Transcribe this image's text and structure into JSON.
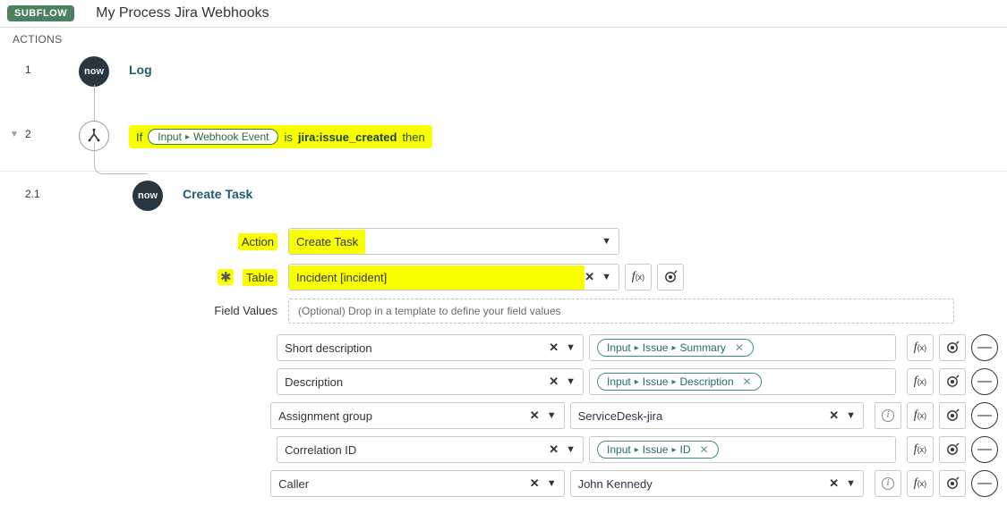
{
  "header": {
    "badge": "SUBFLOW",
    "title": "My Process Jira Webhooks"
  },
  "section_label": "ACTIONS",
  "steps": {
    "s1": {
      "num": "1",
      "label": "Log"
    },
    "s2": {
      "num": "2",
      "if_word": "If",
      "pill_a": "Input",
      "pill_b": "Webhook Event",
      "is_word": "is",
      "value": "jira:issue_created",
      "then_word": "then"
    },
    "s21": {
      "num": "2.1",
      "label": "Create Task"
    }
  },
  "detail": {
    "action_label": "Action",
    "action_value": "Create Task",
    "table_label": "Table",
    "table_value": "Incident [incident]",
    "fv_label": "Field Values",
    "fv_placeholder": "(Optional) Drop in a template to define your field values",
    "rows": [
      {
        "key": "Short description",
        "pill": [
          "Input",
          "Issue",
          "Summary"
        ],
        "kind": "pill"
      },
      {
        "key": "Description",
        "pill": [
          "Input",
          "Issue",
          "Description"
        ],
        "kind": "pill"
      },
      {
        "key": "Assignment group",
        "text": "ServiceDesk-jira",
        "kind": "lookup"
      },
      {
        "key": "Correlation ID",
        "pill": [
          "Input",
          "Issue",
          "ID"
        ],
        "kind": "pill"
      },
      {
        "key": "Caller",
        "text": "John Kennedy",
        "kind": "lookup"
      }
    ]
  }
}
